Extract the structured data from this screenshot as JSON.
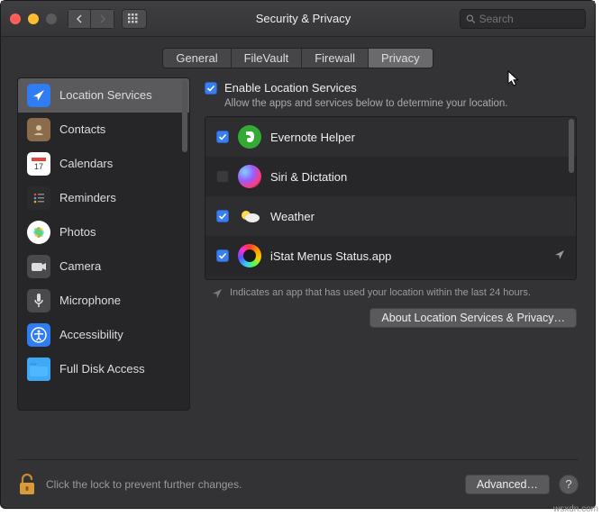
{
  "window": {
    "title": "Security & Privacy"
  },
  "search": {
    "placeholder": "Search"
  },
  "tabs": [
    {
      "label": "General",
      "active": false
    },
    {
      "label": "FileVault",
      "active": false
    },
    {
      "label": "Firewall",
      "active": false
    },
    {
      "label": "Privacy",
      "active": true
    }
  ],
  "sidebar": {
    "items": [
      {
        "label": "Location Services",
        "selected": true,
        "icon": "location",
        "bg": "#2f7cf3"
      },
      {
        "label": "Contacts",
        "selected": false,
        "icon": "contacts",
        "bg": "#8a6b4a"
      },
      {
        "label": "Calendars",
        "selected": false,
        "icon": "calendar",
        "bg": "#ffffff"
      },
      {
        "label": "Reminders",
        "selected": false,
        "icon": "reminders",
        "bg": "#2b2b2d"
      },
      {
        "label": "Photos",
        "selected": false,
        "icon": "photos",
        "bg": "#ffffff"
      },
      {
        "label": "Camera",
        "selected": false,
        "icon": "camera",
        "bg": "#4a4a4c"
      },
      {
        "label": "Microphone",
        "selected": false,
        "icon": "microphone",
        "bg": "#4a4a4c"
      },
      {
        "label": "Accessibility",
        "selected": false,
        "icon": "accessibility",
        "bg": "#2f7cf3"
      },
      {
        "label": "Full Disk Access",
        "selected": false,
        "icon": "folder",
        "bg": "#3fa9f5"
      }
    ]
  },
  "enable": {
    "label": "Enable Location Services",
    "checked": true,
    "subtext": "Allow the apps and services below to determine your location."
  },
  "apps": [
    {
      "name": "Evernote Helper",
      "checked": true,
      "icon": "evernote",
      "indicator": false
    },
    {
      "name": "Siri & Dictation",
      "checked": false,
      "icon": "siri",
      "indicator": false
    },
    {
      "name": "Weather",
      "checked": true,
      "icon": "weather",
      "indicator": false
    },
    {
      "name": "iStat Menus Status.app",
      "checked": true,
      "icon": "istat",
      "indicator": true
    }
  ],
  "indicator_note": "Indicates an app that has used your location within the last 24 hours.",
  "buttons": {
    "about": "About Location Services & Privacy…",
    "advanced": "Advanced…"
  },
  "footer": {
    "lock_text": "Click the lock to prevent further changes."
  },
  "watermark": "wsxdn.com"
}
